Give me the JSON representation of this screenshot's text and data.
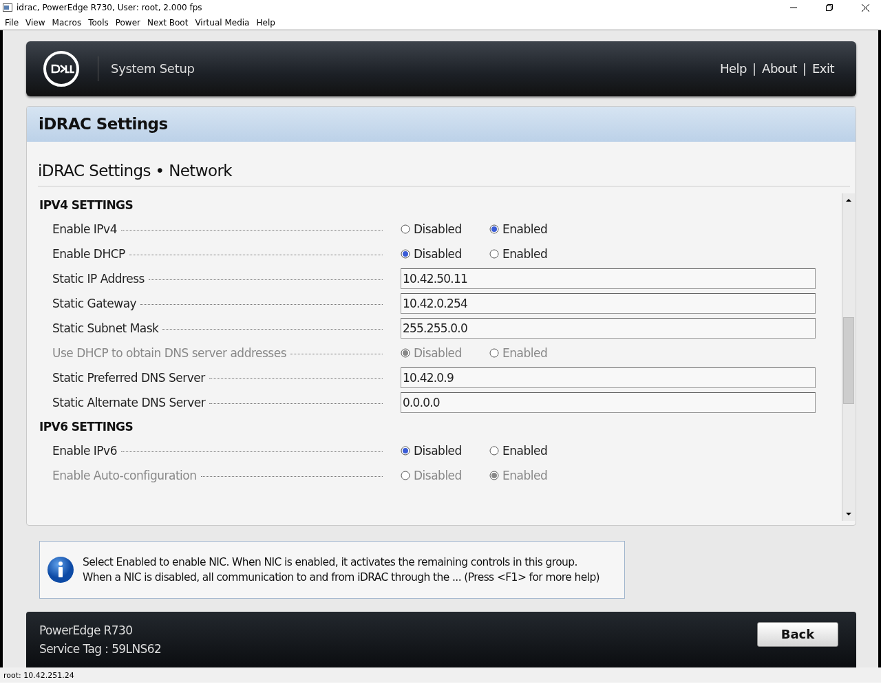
{
  "window": {
    "title": "idrac, PowerEdge R730, User: root, 2.000 fps"
  },
  "menu": [
    "File",
    "View",
    "Macros",
    "Tools",
    "Power",
    "Next Boot",
    "Virtual Media",
    "Help"
  ],
  "header": {
    "app_title": "System Setup",
    "links": [
      "Help",
      "About",
      "Exit"
    ],
    "separator": "|"
  },
  "page_title": "iDRAC Settings",
  "breadcrumb": "iDRAC Settings • Network",
  "sections": [
    {
      "title": "IPV4 SETTINGS",
      "rows": [
        {
          "kind": "radio",
          "label": "Enable IPv4",
          "disabled": false,
          "options": [
            {
              "label": "Disabled",
              "selected": false
            },
            {
              "label": "Enabled",
              "selected": true
            }
          ]
        },
        {
          "kind": "radio",
          "label": "Enable DHCP",
          "disabled": false,
          "options": [
            {
              "label": "Disabled",
              "selected": true
            },
            {
              "label": "Enabled",
              "selected": false
            }
          ]
        },
        {
          "kind": "text",
          "label": "Static IP Address",
          "value": "10.42.50.11"
        },
        {
          "kind": "text",
          "label": "Static Gateway",
          "value": "10.42.0.254"
        },
        {
          "kind": "text",
          "label": "Static Subnet Mask",
          "value": "255.255.0.0"
        },
        {
          "kind": "radio",
          "label": "Use DHCP to obtain DNS server addresses",
          "disabled": true,
          "options": [
            {
              "label": "Disabled",
              "selected": true
            },
            {
              "label": "Enabled",
              "selected": false
            }
          ]
        },
        {
          "kind": "text",
          "label": "Static Preferred DNS Server",
          "value": "10.42.0.9"
        },
        {
          "kind": "text",
          "label": "Static Alternate DNS Server",
          "value": "0.0.0.0"
        }
      ]
    },
    {
      "title": "IPV6 SETTINGS",
      "rows": [
        {
          "kind": "radio",
          "label": "Enable IPv6",
          "disabled": false,
          "options": [
            {
              "label": "Disabled",
              "selected": true
            },
            {
              "label": "Enabled",
              "selected": false
            }
          ]
        },
        {
          "kind": "radio",
          "label": "Enable Auto-configuration",
          "disabled": true,
          "options": [
            {
              "label": "Disabled",
              "selected": false
            },
            {
              "label": "Enabled",
              "selected": true
            }
          ]
        }
      ]
    }
  ],
  "help_text": [
    "Select Enabled to enable NIC. When NIC is enabled, it activates the remaining controls in this group.",
    "When a NIC is disabled, all communication to and from iDRAC through the ... (Press <F1> for more help)"
  ],
  "footer": {
    "model": "PowerEdge R730",
    "service_tag": "Service Tag : 59LNS62",
    "button": "Back"
  },
  "status_bar": "root: 10.42.251.24"
}
